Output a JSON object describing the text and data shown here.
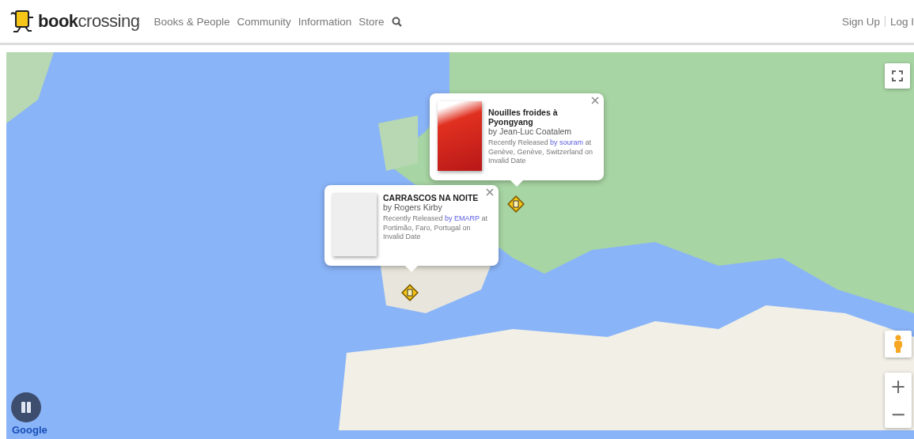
{
  "header": {
    "logo": {
      "bold": "book",
      "rest": "crossing"
    },
    "nav": [
      {
        "label": "Books & People"
      },
      {
        "label": "Community"
      },
      {
        "label": "Information"
      },
      {
        "label": "Store"
      }
    ],
    "auth": [
      {
        "label": "Sign Up"
      },
      {
        "label": "Log I"
      }
    ]
  },
  "map": {
    "popups": [
      {
        "kind": "photo",
        "title": "Nouilles froides à Pyongyang",
        "author": "by Jean-Luc Coatalem",
        "released": "Recently Released",
        "released_by": "by souram",
        "location": "at Genève, Genève, Switzerland on Invalid Date"
      },
      {
        "kind": "placeholder",
        "title": "CARRASCOS NA NOITE",
        "author": "by Rogers Kirby",
        "released": "Recently Released",
        "released_by": "by EMARP",
        "location": "at Portimão, Faro, Portugal on Invalid Date"
      }
    ],
    "controls": {
      "zoom_in": "+",
      "zoom_out": "−"
    },
    "attribution": "Google"
  }
}
